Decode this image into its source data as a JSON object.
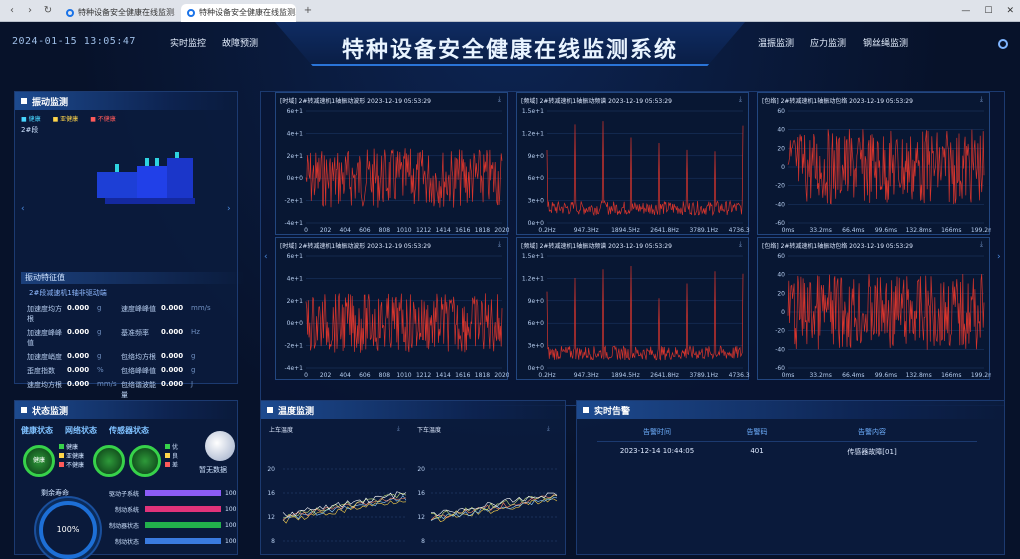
{
  "browser": {
    "tabs": [
      {
        "label": "特种设备安全健康在线监测系统-"
      },
      {
        "label": "特种设备安全健康在线监测系统"
      }
    ]
  },
  "header": {
    "datetime": "2024-01-15 13:05:47",
    "title": "特种设备安全健康在线监测系统",
    "nav_left": [
      "实时监控",
      "故障预测"
    ],
    "nav_right": [
      "温振监测",
      "应力监测",
      "钢丝绳监测"
    ]
  },
  "vibration": {
    "title": "振动监测",
    "legend": [
      "健康",
      "亚健康",
      "不健康"
    ],
    "device": "2#段",
    "feature_title": "振动特征值",
    "feature_sub": "2#段减速机1轴非驱动端",
    "rows": [
      [
        "加速度均方根",
        "0.000",
        "g",
        "速度峰峰值",
        "0.000",
        "mm/s"
      ],
      [
        "加速度峰峰值",
        "0.000",
        "g",
        "基准频率",
        "0.000",
        "Hz"
      ],
      [
        "加速度峭度",
        "0.000",
        "g",
        "包络均方根",
        "0.000",
        "g"
      ],
      [
        "歪度指数",
        "0.000",
        "%",
        "包络峰峰值",
        "0.000",
        "g"
      ],
      [
        "速度均方根",
        "0.000",
        "mm/s",
        "包络谐波能量",
        "0.000",
        "J"
      ]
    ]
  },
  "charts": {
    "row1": [
      {
        "title": "[时域] 2#转减速机1轴振动波形 2023-12-19 05:53:29"
      },
      {
        "title": "[频域] 2#转减速机1轴振动频谱 2023-12-19 05:53:29"
      },
      {
        "title": "[包络] 2#转减速机1轴振动包络 2023-12-19 05:53:29"
      }
    ],
    "row2": [
      {
        "title": "[时域] 2#转减速机1轴振动波形 2023-12-19 05:53:29"
      },
      {
        "title": "[频域] 2#转减速机1轴振动频谱 2023-12-19 05:53:29"
      },
      {
        "title": "[包络] 2#转减速机1轴振动包络 2023-12-19 05:53:29"
      }
    ]
  },
  "chart_data": [
    {
      "type": "line",
      "title": "[时域] 2#转减速机1轴振动波形 2023-12-19 05:53:29",
      "x": [
        0,
        202,
        404,
        606,
        808,
        1010,
        1212,
        1414,
        1616,
        1818,
        2020
      ],
      "ylim": [
        -4,
        6
      ],
      "yticks": [
        "-4e+1",
        "-2e+1",
        "0e+0",
        "2e+1",
        "4e+1",
        "6e+1"
      ],
      "color": "#d6352d"
    },
    {
      "type": "line",
      "title": "[频域] 2#转减速机1轴振动频谱 2023-12-19 05:53:29",
      "x": [
        "0.2Hz",
        "947.3Hz",
        "1894.5Hz",
        "2641.8Hz",
        "3789.1Hz",
        "4736.3Hz"
      ],
      "ylim": [
        0,
        1.5
      ],
      "yticks": [
        "0e+0",
        "3e+0",
        "6e+0",
        "9e+0",
        "1.2e+1",
        "1.5e+1"
      ],
      "color": "#d6352d"
    },
    {
      "type": "line",
      "title": "[包络] 2#转减速机1轴振动包络 2023-12-19 05:53:29",
      "x": [
        "0ms",
        "33.2ms",
        "66.4ms",
        "99.6ms",
        "132.8ms",
        "166ms",
        "199.2ms"
      ],
      "ylim": [
        -60,
        60
      ],
      "yticks": [
        "-60",
        "-40",
        "-20",
        "0",
        "20",
        "40",
        "60"
      ],
      "color": "#d6352d"
    },
    {
      "type": "line",
      "title": "[时域] 2#转减速机1轴振动波形 2023-12-19 05:53:29",
      "x": [
        0,
        202,
        404,
        606,
        808,
        1010,
        1212,
        1414,
        1616,
        1818,
        2020
      ],
      "ylim": [
        -4,
        6
      ],
      "yticks": [
        "-4e+1",
        "-2e+1",
        "0e+0",
        "2e+1",
        "4e+1",
        "6e+1"
      ],
      "color": "#d6352d"
    },
    {
      "type": "line",
      "title": "[频域] 2#转减速机1轴振动频谱 2023-12-19 05:53:29",
      "x": [
        "0.2Hz",
        "947.3Hz",
        "1894.5Hz",
        "2641.8Hz",
        "3789.1Hz",
        "4736.3Hz"
      ],
      "ylim": [
        0,
        1.5
      ],
      "yticks": [
        "0e+0",
        "3e+0",
        "6e+0",
        "9e+0",
        "1.2e+1",
        "1.5e+1"
      ],
      "color": "#d6352d"
    },
    {
      "type": "line",
      "title": "[包络] 2#转减速机1轴振动包络 2023-12-19 05:53:29",
      "x": [
        "0ms",
        "33.2ms",
        "66.4ms",
        "99.6ms",
        "132.8ms",
        "166ms",
        "199.2ms"
      ],
      "ylim": [
        -60,
        60
      ],
      "yticks": [
        "-60",
        "-40",
        "-20",
        "0",
        "20",
        "40",
        "60"
      ],
      "color": "#d6352d"
    }
  ],
  "status": {
    "title": "状态监测",
    "headers": [
      "健康状态",
      "网络状态",
      "传感器状态"
    ],
    "health_label": "健康",
    "health_legend": [
      "健康",
      "亚健康",
      "不健康"
    ],
    "sensor_legend": [
      "优",
      "良",
      "差"
    ],
    "nodata": "暂无数据",
    "life_label": "剩余寿命",
    "life_value": "100%",
    "bars": [
      {
        "label": "驱动子系统",
        "value": "100",
        "color": "#8b5cf6"
      },
      {
        "label": "制动系统",
        "value": "100",
        "color": "#e0337a"
      },
      {
        "label": "制动器状态",
        "value": "100",
        "color": "#22b14c"
      },
      {
        "label": "制动状态",
        "value": "100",
        "color": "#3a7be0"
      }
    ]
  },
  "temperature": {
    "title": "温度监测",
    "left_title": "上车温度",
    "right_title": "下车温度",
    "yticks": [
      "8",
      "12",
      "16",
      "20"
    ]
  },
  "alarm": {
    "title": "实时告警",
    "headers": [
      "告警时间",
      "告警码",
      "告警内容"
    ],
    "rows": [
      [
        "2023-12-14 10:44:05",
        "401",
        "传感器故障[01]"
      ]
    ]
  }
}
